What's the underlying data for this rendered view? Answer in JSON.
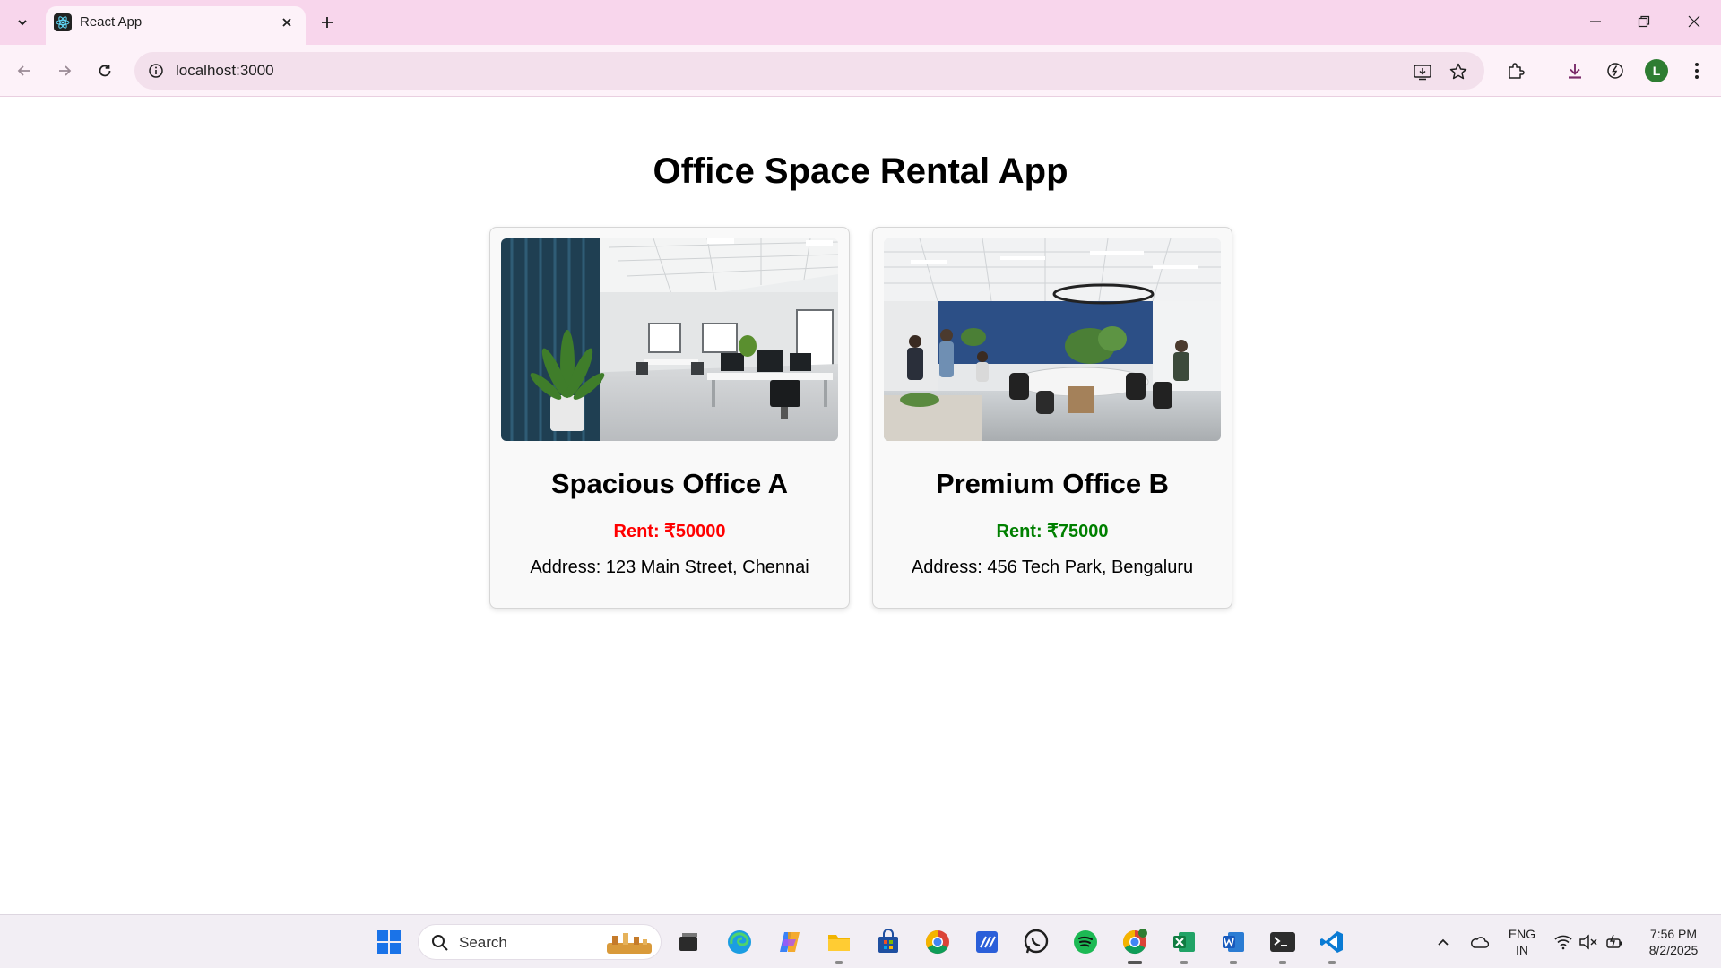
{
  "browser": {
    "tab": {
      "title": "React App",
      "favicon": "react-atom-icon"
    },
    "url": "localhost:3000",
    "profile_initial": "L"
  },
  "page": {
    "title": "Office Space Rental App",
    "offices": [
      {
        "name": "Spacious Office A",
        "rent": "Rent: ₹50000",
        "rent_color": "#ff0000",
        "address": "Address: 123 Main Street, Chennai",
        "image": "office-interior-photo"
      },
      {
        "name": "Premium Office B",
        "rent": "Rent: ₹75000",
        "rent_color": "#008000",
        "address": "Address: 456 Tech Park, Bengaluru",
        "image": "coworking-office-photo"
      }
    ]
  },
  "taskbar": {
    "search_placeholder": "Search",
    "apps": [
      "windows-start-icon",
      "search-icon",
      "task-view-icon",
      "edge-icon",
      "copilot-icon",
      "file-explorer-icon",
      "microsoft-store-icon",
      "chrome-icon",
      "visual-studio-icon",
      "whatsapp-icon",
      "spotify-icon",
      "chrome-profile-icon",
      "excel-icon",
      "word-icon",
      "terminal-icon",
      "vscode-icon"
    ],
    "language_line1": "ENG",
    "language_line2": "IN",
    "time": "7:56 PM",
    "date": "8/2/2025"
  }
}
